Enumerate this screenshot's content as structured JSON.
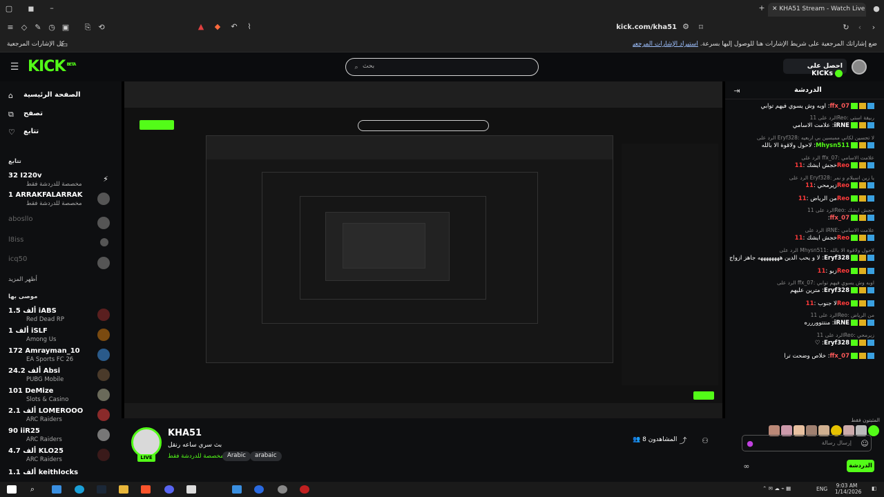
{
  "browser": {
    "tab_title": "KHA51 Stream - Watch Live ...",
    "url": "kick.com/kha51",
    "bookmarks_all": "كل الإشارات المرجعية",
    "bookmarks_hint": "ضع إشاراتك المرجعية على شريط الإشارات هنا للوصول إليها بسرعة.",
    "bookmarks_import": "استيراد الإشارات المرجعية الآن..."
  },
  "header": {
    "logo": "KICK",
    "logo_sup": "BETA",
    "search_placeholder": "بحث",
    "get_kicks": "احصل على KICKs"
  },
  "sidebar": {
    "nav": [
      "الصفحة الرئيسية",
      "تصفح",
      "تتابع"
    ],
    "following_title": "تتابع",
    "following": [
      {
        "name": "I220v",
        "count": "32",
        "sub": "مخصصة للدردشة فقط"
      },
      {
        "name": "ARRAKFALARRAK",
        "count": "1",
        "sub": "مخصصة للدردشة فقط"
      },
      {
        "name": "abosllo",
        "count": "",
        "sub": ""
      },
      {
        "name": "l8iss",
        "count": "",
        "sub": ""
      },
      {
        "name": "icq50",
        "count": "",
        "sub": ""
      }
    ],
    "show_more": "أظهر المزيد",
    "recommended_title": "موصى بها",
    "recommended": [
      {
        "name": "iABS",
        "count": "1.5 ألف",
        "sub": "Red Dead RP"
      },
      {
        "name": "iSLF",
        "count": "1 ألف",
        "sub": "Among Us"
      },
      {
        "name": "Amrayman_10",
        "count": "172",
        "sub": "EA Sports FC 26"
      },
      {
        "name": "Absi",
        "count": "24.2 ألف",
        "sub": "PUBG Mobile"
      },
      {
        "name": "DeMize",
        "count": "101",
        "sub": "Slots & Casino"
      },
      {
        "name": "LOMEROOO",
        "count": "2.1 ألف",
        "sub": "ARC Raiders"
      },
      {
        "name": "iiR25",
        "count": "90",
        "sub": "ARC Raiders"
      },
      {
        "name": "KLO25",
        "count": "4.7 ألف",
        "sub": "ARC Raiders"
      },
      {
        "name": "keithlocks",
        "count": "1.1 ألف",
        "sub": ""
      }
    ]
  },
  "stream": {
    "name": "KHA51",
    "title": "بث سري ساعه رنقل",
    "category": "مخصصة للدردشة فقط",
    "tags": [
      "Arabic",
      "arabaic"
    ],
    "live": "LIVE",
    "viewers_label": "المشاهدون",
    "viewers": "8"
  },
  "chat": {
    "title": "الدردشة",
    "messages": [
      {
        "reply": "",
        "user": "ffx_07",
        "color": "#ff5a5a",
        "text": "اوبه وش يسوي فيهم توابي"
      },
      {
        "reply": "الرد على 11Reo: ربيقة استي",
        "user": "iRNE",
        "color": "#ffffff",
        "text": "علامت الاسامي"
      },
      {
        "reply": "الرد على Eryf328: لا تحسين لكاني ممبسين بي اربعيه",
        "user": "Mhysn511",
        "color": "#53fc18",
        "text": "لاحول ولاقوة الا بالله"
      },
      {
        "reply": "الرد على ffx_07: علامت الاسامي",
        "user": "11Reo",
        "color": "#ff3b3b",
        "text": "خجش ايشك"
      },
      {
        "reply": "الرد على Eryf328: يا زين اسبلام و نمر",
        "user": "11Reo",
        "color": "#ff3b3b",
        "text": "زيرمحي"
      },
      {
        "reply": "",
        "user": "11Reo",
        "color": "#ff3b3b",
        "text": "من الرياض"
      },
      {
        "reply": "الرد على 11Reo: خجش ايشك",
        "user": "ffx_07",
        "color": "#ff5a5a",
        "text": ""
      },
      {
        "reply": "الرد على iRNE: علامت الاسامي",
        "user": "11Reo",
        "color": "#ff3b3b",
        "text": "خجش ايشك"
      },
      {
        "reply": "الرد على Mhysn511: لاحول ولاقوة الا بالله",
        "user": "Eryf328",
        "color": "#ffffff",
        "text": "لا و يحب الدين ههههههههه جاهز ازواج"
      },
      {
        "reply": "",
        "user": "11Reo",
        "color": "#ff3b3b",
        "text": "زبو"
      },
      {
        "reply": "الرد على ffx_07: اوبه وش يسوي فيهم توابي",
        "user": "Eryf328",
        "color": "#ffffff",
        "text": "مترين عليهم"
      },
      {
        "reply": "",
        "user": "11Reo",
        "color": "#ff3b3b",
        "text": "لا جنوب"
      },
      {
        "reply": "الرد على 11Reo: من الرياض",
        "user": "iRNE",
        "color": "#ffffff",
        "text": "منتتووررره"
      },
      {
        "reply": "الرد على 11Reo: زيرمحي",
        "user": "Eryf328",
        "color": "#ffffff",
        "text": "♡"
      },
      {
        "reply": "",
        "user": "ffx_07",
        "color": "#ff5a5a",
        "text": "خلاص وضحت ترا"
      }
    ],
    "pinned_label": "المثبتون فقط",
    "input_placeholder": "إرسال رسالة",
    "send_button": "الدردشة"
  },
  "taskbar": {
    "lang": "ENG",
    "time": "9:03 AM",
    "date": "1/14/2026"
  }
}
